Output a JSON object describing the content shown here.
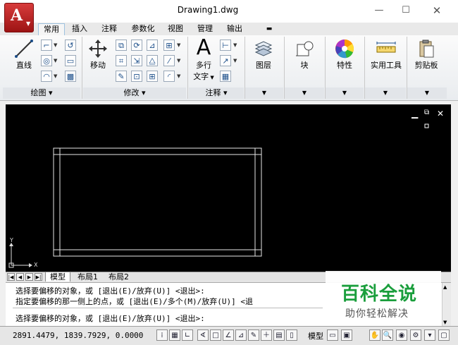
{
  "window": {
    "title": "Drawing1.dwg",
    "app_logo": "A"
  },
  "tabs": [
    "常用",
    "插入",
    "注释",
    "参数化",
    "视图",
    "管理",
    "输出"
  ],
  "ribbon": {
    "panels": {
      "draw": "绘图",
      "modify": "修改",
      "annotation": "注释"
    },
    "buttons": {
      "line": "直线",
      "move": "移动",
      "mtext_1": "多行",
      "mtext_2": "文字",
      "layers": "图层",
      "block": "块",
      "properties": "特性",
      "utilities": "实用工具",
      "clipboard": "剪贴板"
    }
  },
  "layout_tabs": [
    "模型",
    "布局1",
    "布局2"
  ],
  "command_lines": [
    "选择要偏移的对象，或 [退出(E)/放弃(U)] <退出>:",
    "指定要偏移的那一侧上的点，或 [退出(E)/多个(M)/放弃(U)] <退",
    "选择要偏移的对象，或 [退出(E)/放弃(U)] <退出>:"
  ],
  "watermark": {
    "title": "百科全说",
    "subtitle": "助你轻松解决"
  },
  "status": {
    "coords": "2891.4479, 1839.7929, 0.0000",
    "model": "模型"
  },
  "ucs": {
    "x": "X",
    "y": "Y"
  },
  "colors": {
    "accent": "#c62a2a",
    "canvas": "#000000",
    "watermark_green": "#1a9e3c"
  }
}
